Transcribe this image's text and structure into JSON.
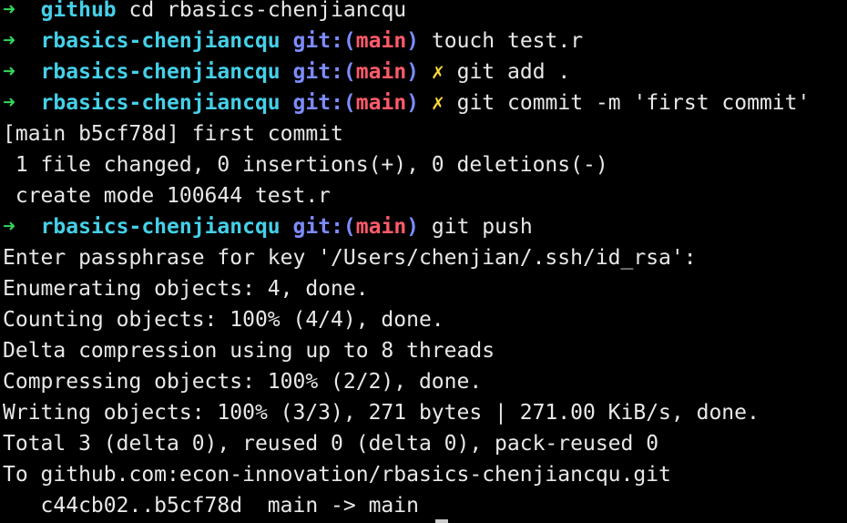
{
  "theme": {
    "background": "#000000",
    "text": "#e8e8e8",
    "arrow": "#33d65a",
    "directory": "#45d0e8",
    "git_label": "#7d8cff",
    "branch": "#ff5a6a",
    "dirty_marker": "#ffd93a"
  },
  "prompt": {
    "arrow": "➜",
    "git_open": "git:(",
    "branch": "main",
    "git_close": ")",
    "dirty": "✗"
  },
  "lines": {
    "l1": {
      "dir": "github",
      "cmd": "cd rbasics-chenjiancqu"
    },
    "l2": {
      "dir": "rbasics-chenjiancqu",
      "cmd": "touch test.r"
    },
    "l3": {
      "dir": "rbasics-chenjiancqu",
      "cmd": "git add ."
    },
    "l4": {
      "dir": "rbasics-chenjiancqu",
      "cmd": "git commit -m 'first commit'"
    },
    "l5": {
      "text": "[main b5cf78d] first commit"
    },
    "l6": {
      "text": " 1 file changed, 0 insertions(+), 0 deletions(-)"
    },
    "l7": {
      "text": " create mode 100644 test.r"
    },
    "l8": {
      "dir": "rbasics-chenjiancqu",
      "cmd": "git push"
    },
    "l9": {
      "text": "Enter passphrase for key '/Users/chenjian/.ssh/id_rsa':"
    },
    "l10": {
      "text": "Enumerating objects: 4, done."
    },
    "l11": {
      "text": "Counting objects: 100% (4/4), done."
    },
    "l12": {
      "text": "Delta compression using up to 8 threads"
    },
    "l13": {
      "text": "Compressing objects: 100% (2/2), done."
    },
    "l14": {
      "text": "Writing objects: 100% (3/3), 271 bytes | 271.00 KiB/s, done."
    },
    "l15": {
      "text": "Total 3 (delta 0), reused 0 (delta 0), pack-reused 0"
    },
    "l16": {
      "text": "To github.com:econ-innovation/rbasics-chenjiancqu.git"
    },
    "l17": {
      "text": "   c44cb02..b5cf78d  main -> main"
    }
  }
}
